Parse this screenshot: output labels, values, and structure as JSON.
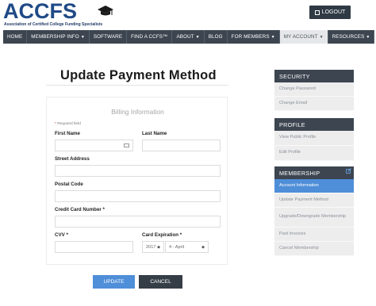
{
  "header": {
    "logo_text": "ACCFS",
    "logo_subtitle": "Association of Certified College Funding Specialists",
    "logout_label": "LOGOUT"
  },
  "nav": {
    "items": [
      {
        "label": "HOME",
        "dropdown": false
      },
      {
        "label": "MEMBERSHIP INFO",
        "dropdown": true
      },
      {
        "label": "SOFTWARE",
        "dropdown": false
      },
      {
        "label": "FIND A CCFS™",
        "dropdown": false
      },
      {
        "label": "ABOUT",
        "dropdown": true
      },
      {
        "label": "BLOG",
        "dropdown": false
      },
      {
        "label": "FOR MEMBERS",
        "dropdown": true
      },
      {
        "label": "MY ACCOUNT",
        "dropdown": true,
        "active": true
      },
      {
        "label": "RESOURCES",
        "dropdown": true
      }
    ]
  },
  "page": {
    "title": "Update Payment Method"
  },
  "form": {
    "legend": "Billing Information",
    "required_note": "Required field",
    "required_star": "*",
    "first_name_label": "First Name",
    "last_name_label": "Last Name",
    "street_label": "Street Address",
    "postal_label": "Postal Code",
    "card_number_label": "Credit Card Number *",
    "cvv_label": "CVV *",
    "expiration_label": "Card Expiration *",
    "exp_year": "2017",
    "exp_month": "4 - April",
    "first_name_value": "",
    "last_name_value": "",
    "street_value": "",
    "postal_value": "",
    "card_number_value": "",
    "cvv_value": ""
  },
  "buttons": {
    "update": "UPDATE",
    "cancel": "CANCEL"
  },
  "sidebar": {
    "security": {
      "heading": "SECURITY",
      "items": [
        "Change Password",
        "Change Email"
      ]
    },
    "profile": {
      "heading": "PROFILE",
      "items": [
        "View Public Profile",
        "Edit Profile"
      ]
    },
    "membership": {
      "heading": "MEMBERSHIP",
      "items": [
        "Account Information",
        "Update Payment Method",
        "Upgrade/Downgrade Membership",
        "Past Invoices",
        "Cancel Membership"
      ]
    }
  },
  "colors": {
    "brand_blue": "#1f4a86",
    "nav_bg": "#3d4650",
    "accent": "#4f8ed8",
    "dark_button": "#353d46"
  }
}
